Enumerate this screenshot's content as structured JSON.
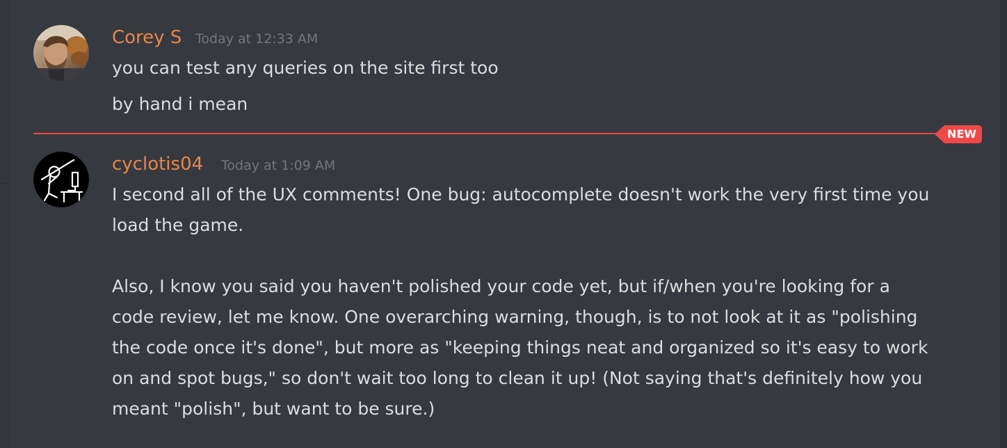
{
  "messages": [
    {
      "author": "Corey S",
      "timestamp": "Today at 12:33 AM",
      "avatar_icon": "user-photo-avatar",
      "lines": [
        "you can test any queries on the site first too",
        "by hand i mean"
      ]
    },
    {
      "author": "cyclotis04",
      "timestamp": "Today at 1:09 AM",
      "avatar_icon": "stick-figure-avatar",
      "lines": [
        "I second all of the UX comments! One bug: autocomplete doesn't work the very first time you",
        "load the game.",
        "Also, I know you said you haven't polished your code yet, but if/when you're looking for a",
        "code review, let me know. One overarching warning, though, is to not look at it as \"polishing",
        "the code once it's done\", but more as \"keeping things neat and organized so it's easy to work",
        "on and spot bugs,\" so don't wait too long to clean it up! (Not saying that's definitely how you",
        "meant \"polish\", but want to be sure.)"
      ]
    }
  ],
  "new_divider": {
    "label": "NEW",
    "color": "#f04747"
  },
  "colors": {
    "background": "#36393f",
    "username": "#e8864a",
    "timestamp": "#72767d",
    "message_text": "#dcddde"
  }
}
